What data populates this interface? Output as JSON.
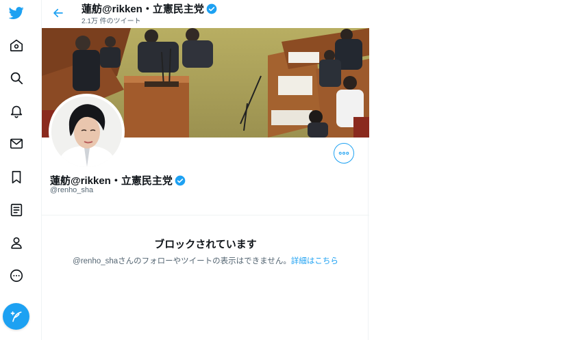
{
  "nav": {
    "items": [
      {
        "icon": "twitter-logo-icon"
      },
      {
        "icon": "home-icon"
      },
      {
        "icon": "explore-icon"
      },
      {
        "icon": "notifications-icon"
      },
      {
        "icon": "messages-icon"
      },
      {
        "icon": "bookmarks-icon"
      },
      {
        "icon": "lists-icon"
      },
      {
        "icon": "profile-icon"
      },
      {
        "icon": "more-icon"
      }
    ],
    "compose_icon": "compose-tweet-icon"
  },
  "header": {
    "title": "蓮舫@rikken・立憲民主党",
    "subtitle": "2.1万 件のツイート",
    "back_icon": "back-arrow-icon"
  },
  "profile": {
    "name": "蓮舫@rikken・立憲民主党",
    "handle": "@renho_sha",
    "verified_icon": "verified-badge-icon",
    "more_icon": "more-options-icon"
  },
  "blocked": {
    "title": "ブロックされています",
    "message": "@renho_shaさんのフォローやツイートの表示はできません。",
    "link": "詳細はこちら"
  },
  "colors": {
    "accent": "#1da1f2",
    "text": "#0f1419",
    "secondary_text": "#536471",
    "border": "#eff3f4"
  }
}
